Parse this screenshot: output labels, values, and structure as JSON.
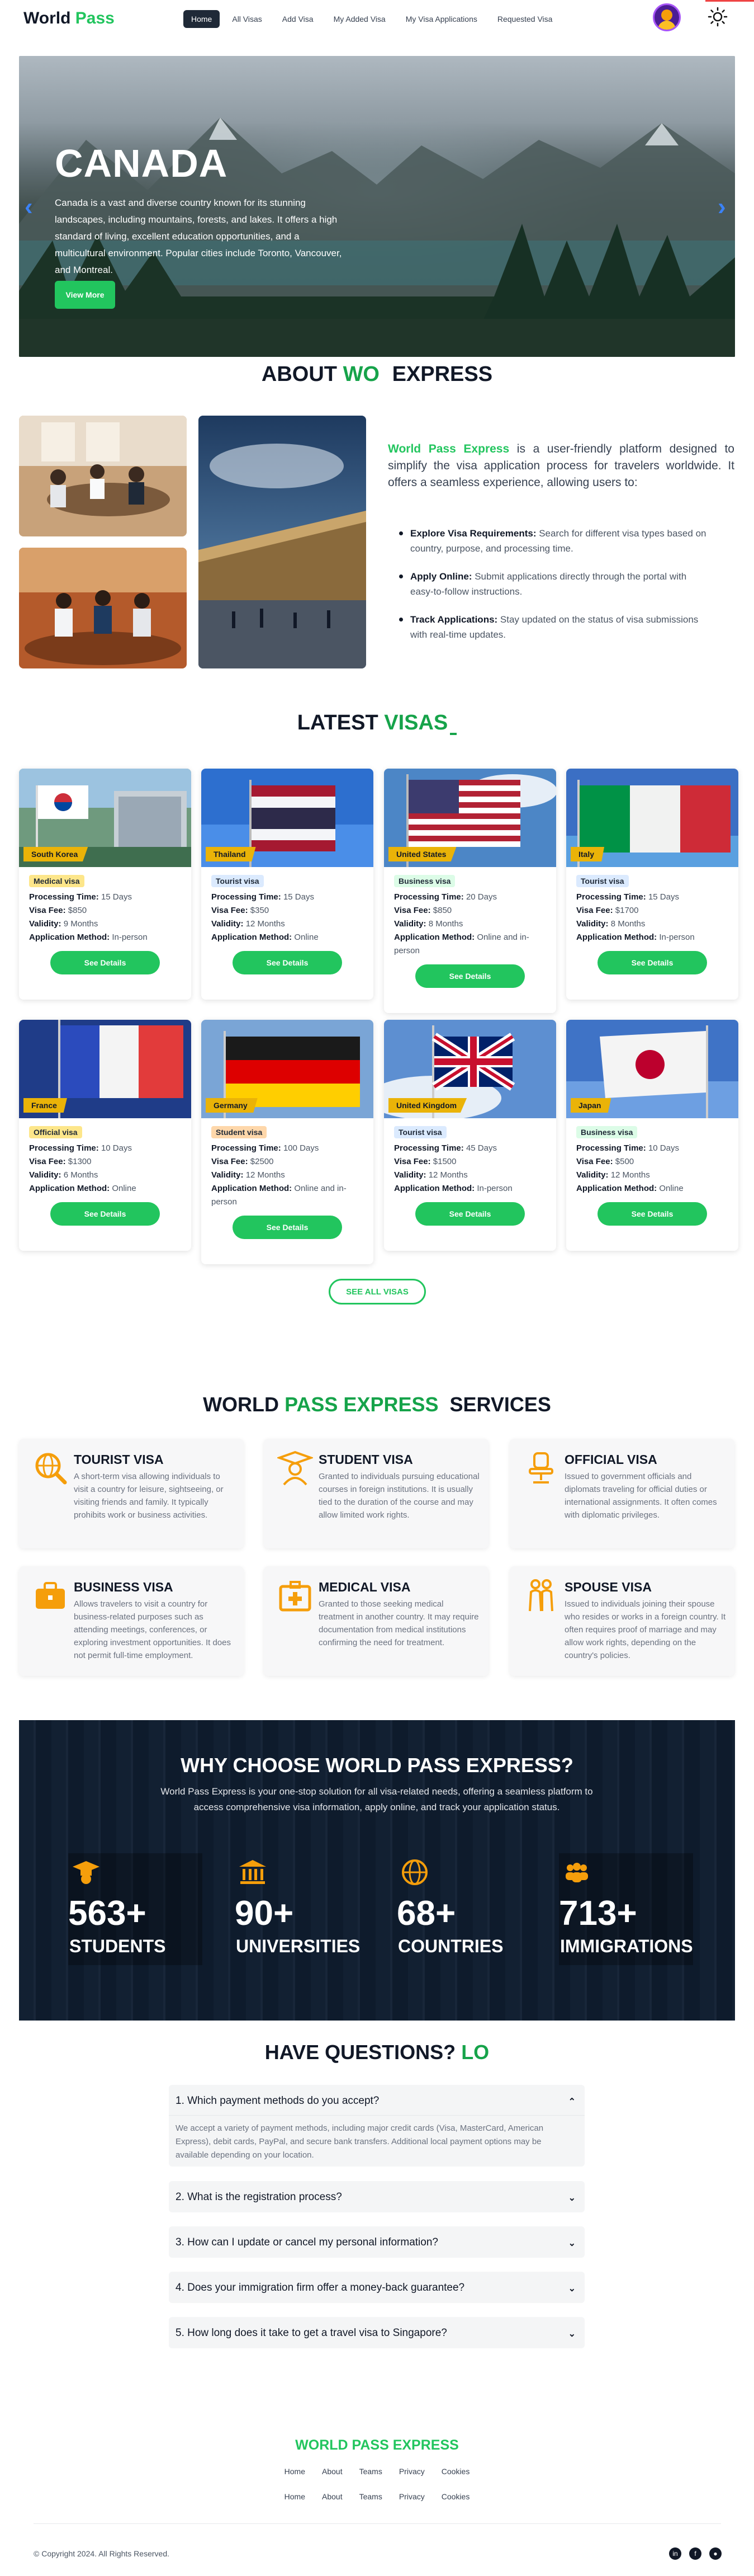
{
  "brand": {
    "part1": "World",
    "part2": "Pass"
  },
  "nav": {
    "items": [
      {
        "label": "Home",
        "active": true
      },
      {
        "label": "All Visas"
      },
      {
        "label": "Add Visa"
      },
      {
        "label": "My Added Visa"
      },
      {
        "label": "My Visa Applications"
      },
      {
        "label": "Requested Visa"
      }
    ],
    "avatar_icon": "user-avatar",
    "theme_icon": "sun-icon"
  },
  "hero": {
    "title": "CANADA",
    "text": "Canada is a vast and diverse country known for its stunning landscapes, including mountains, forests, and lakes. It offers a high standard of living, excellent education opportunities, and a multicultural environment. Popular cities include Toronto, Vancouver, and Montreal.",
    "button": "View More",
    "prev_icon": "chevron-left-icon",
    "next_icon": "chevron-right-icon"
  },
  "about": {
    "title_a": "ABOUT",
    "title_b": "WO",
    "title_c": "EXPRESS",
    "brand_name": "World Pass Express",
    "intro": " is a user-friendly platform designed to simplify the visa application process for travelers worldwide. It offers a seamless experience, allowing users to:",
    "points": [
      {
        "title": "Explore Visa Requirements:",
        "text": " Search for different visa types based on country, purpose, and processing time."
      },
      {
        "title": "Apply Online:",
        "text": " Submit applications directly through the portal with easy-to-follow instructions."
      },
      {
        "title": "Track Applications:",
        "text": " Stay updated on the status of visa submissions with real-time updates."
      }
    ]
  },
  "latest": {
    "title_a": "LATEST",
    "title_b": "VISAS",
    "labels": {
      "processing": "Processing Time:",
      "fee": "Visa Fee:",
      "validity": "Validity:",
      "method": "Application Method:"
    },
    "button": "See Details",
    "see_all": "SEE ALL VISAS",
    "cards": [
      {
        "country": "South Korea",
        "type": "Medical visa",
        "type_bg": "#fde68a",
        "processing": "15 Days",
        "fee": "$850",
        "validity": "9 Months",
        "method": "In-person"
      },
      {
        "country": "Thailand",
        "type": "Tourist visa",
        "type_bg": "#dbeafe",
        "processing": "15 Days",
        "fee": "$350",
        "validity": "12 Months",
        "method": "Online"
      },
      {
        "country": "United States",
        "type": "Business visa",
        "type_bg": "#dcfce7",
        "processing": "20 Days",
        "fee": "$850",
        "validity": "8 Months",
        "method": "Online and in-person"
      },
      {
        "country": "Italy",
        "type": "Tourist visa",
        "type_bg": "#dbeafe",
        "processing": "15 Days",
        "fee": "$1700",
        "validity": "8 Months",
        "method": "In-person"
      },
      {
        "country": "France",
        "type": "Official visa",
        "type_bg": "#fde68a",
        "processing": "10 Days",
        "fee": "$1300",
        "validity": "6 Months",
        "method": "Online"
      },
      {
        "country": "Germany",
        "type": "Student visa",
        "type_bg": "#fed7aa",
        "processing": "100 Days",
        "fee": "$2500",
        "validity": "12 Months",
        "method": "Online and in-person"
      },
      {
        "country": "United Kingdom",
        "type": "Tourist visa",
        "type_bg": "#dbeafe",
        "processing": "45 Days",
        "fee": "$1500",
        "validity": "12 Months",
        "method": "In-person"
      },
      {
        "country": "Japan",
        "type": "Business visa",
        "type_bg": "#dcfce7",
        "processing": "10 Days",
        "fee": "$500",
        "validity": "12 Months",
        "method": "Online"
      }
    ]
  },
  "services": {
    "title_a": "WORLD",
    "title_b": "PASS EXPRESS",
    "title_c": "SERVICES",
    "items": [
      {
        "title": "TOURIST VISA",
        "icon": "globe-search-icon",
        "text": "A short-term visa allowing individuals to visit a country for leisure, sightseeing, or visiting friends and family. It typically prohibits work or business activities."
      },
      {
        "title": "STUDENT VISA",
        "icon": "graduate-icon",
        "text": "Granted to individuals pursuing educational courses in foreign institutions. It is usually tied to the duration of the course and may allow limited work rights."
      },
      {
        "title": "OFFICIAL VISA",
        "icon": "office-chair-icon",
        "text": "Issued to government officials and diplomats traveling for official duties or international assignments. It often comes with diplomatic privileges."
      },
      {
        "title": "BUSINESS VISA",
        "icon": "briefcase-icon",
        "text": "Allows travelers to visit a country for business-related purposes such as attending meetings, conferences, or exploring investment opportunities. It does not permit full-time employment."
      },
      {
        "title": "MEDICAL VISA",
        "icon": "medical-kit-icon",
        "text": "Granted to those seeking medical treatment in another country. It may require documentation from medical institutions confirming the need for treatment."
      },
      {
        "title": "SPOUSE VISA",
        "icon": "couple-icon",
        "text": "Issued to individuals joining their spouse who resides or works in a foreign country. It often requires proof of marriage and may allow work rights, depending on the country's policies."
      }
    ],
    "icon_color": "#f59e0b"
  },
  "why": {
    "title": "WHY CHOOSE WORLD PASS EXPRESS?",
    "text": "World Pass Express is your one-stop solution for all visa-related needs, offering a seamless platform to access comprehensive visa information, apply online, and track your application status.",
    "stats": [
      {
        "num": "563+",
        "label": "STUDENTS",
        "icon": "graduate-cap-icon"
      },
      {
        "num": "90+",
        "label": "UNIVERSITIES",
        "icon": "university-icon"
      },
      {
        "num": "68+",
        "label": "COUNTRIES",
        "icon": "globe-icon"
      },
      {
        "num": "713+",
        "label": "IMMIGRATIONS",
        "icon": "people-group-icon"
      }
    ]
  },
  "faq": {
    "title_a": "HAVE QUESTIONS?",
    "title_b": "LO",
    "items": [
      {
        "q": "1. Which payment methods do you accept?",
        "a": "We accept a variety of payment methods, including major credit cards (Visa, MasterCard, American Express), debit cards, PayPal, and secure bank transfers. Additional local payment options may be available depending on your location.",
        "open": true
      },
      {
        "q": "2. What is the registration process?"
      },
      {
        "q": "3. How can I update or cancel my personal information?"
      },
      {
        "q": "4. Does your immigration firm offer a money-back guarantee?"
      },
      {
        "q": "5. How long does it take to get a travel visa to Singapore?"
      }
    ]
  },
  "footer": {
    "brand": "WORLD PASS EXPRESS",
    "links_row1": [
      "Home",
      "About",
      "Teams",
      "Privacy",
      "Cookies"
    ],
    "links_row2": [
      "Home",
      "About",
      "Teams",
      "Privacy",
      "Cookies"
    ],
    "copyright": "© Copyright 2024. All Rights Reserved.",
    "social": [
      "linkedin-icon",
      "facebook-icon",
      "github-icon"
    ]
  }
}
